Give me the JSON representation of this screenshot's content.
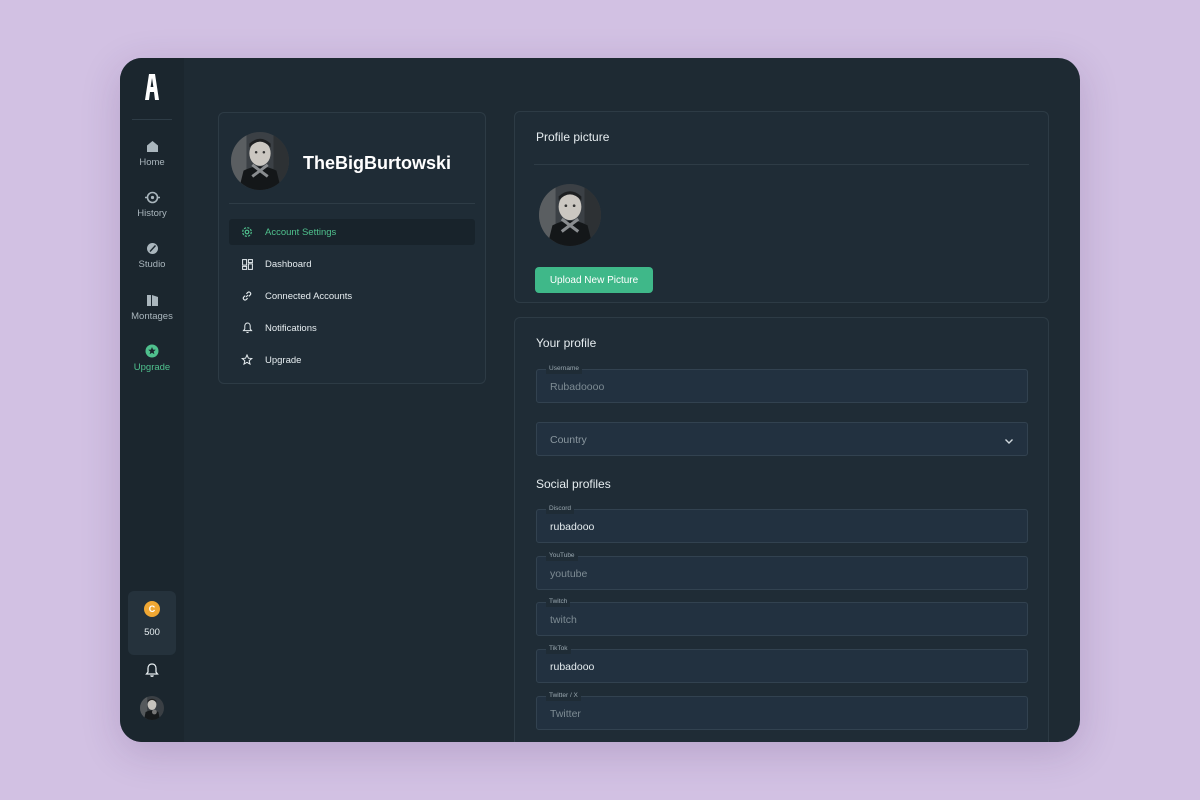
{
  "sidebar": {
    "logo_icon": "a-logo-icon",
    "items": [
      {
        "label": "Home",
        "icon": "home-icon"
      },
      {
        "label": "History",
        "icon": "history-icon"
      },
      {
        "label": "Studio",
        "icon": "studio-icon"
      },
      {
        "label": "Montages",
        "icon": "montages-icon"
      },
      {
        "label": "Upgrade",
        "icon": "upgrade-icon"
      }
    ],
    "coins": {
      "symbol": "C",
      "value": "500"
    },
    "accent_color": "#4fc08d"
  },
  "menu": {
    "username": "TheBigBurtowski",
    "items": [
      {
        "label": "Account Settings",
        "icon": "gear-icon",
        "active": true
      },
      {
        "label": "Dashboard",
        "icon": "dashboard-icon"
      },
      {
        "label": "Connected Accounts",
        "icon": "link-icon"
      },
      {
        "label": "Notifications",
        "icon": "bell-icon"
      },
      {
        "label": "Upgrade",
        "icon": "star-icon"
      }
    ]
  },
  "profile_picture": {
    "title": "Profile picture",
    "upload_label": "Upload New Picture",
    "button_color": "#3fb889"
  },
  "profile": {
    "title": "Your profile",
    "username": {
      "label": "Username",
      "value": "",
      "placeholder": "Rubadoooo"
    },
    "country": {
      "placeholder": "Country"
    }
  },
  "social": {
    "title": "Social profiles",
    "fields": [
      {
        "label": "Discord",
        "value": "rubadooo",
        "placeholder": ""
      },
      {
        "label": "YouTube",
        "value": "",
        "placeholder": "youtube"
      },
      {
        "label": "Twitch",
        "value": "",
        "placeholder": "twitch"
      },
      {
        "label": "TikTok",
        "value": "rubadooo",
        "placeholder": ""
      },
      {
        "label": "Twitter / X",
        "value": "",
        "placeholder": "Twitter"
      }
    ]
  }
}
